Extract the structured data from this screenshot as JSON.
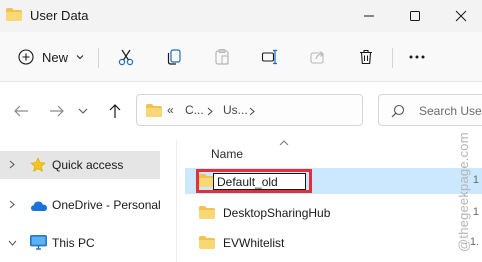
{
  "window": {
    "title": "User Data",
    "controls": [
      "minimize",
      "maximize",
      "close"
    ]
  },
  "toolbar": {
    "new_label": "New",
    "actions": [
      "cut-icon",
      "copy-icon",
      "paste-icon",
      "rename-icon",
      "share-icon",
      "delete-icon",
      "more-icon"
    ]
  },
  "address": {
    "chevron": "«",
    "crumbs": [
      "C...",
      "Us..."
    ],
    "search_placeholder": "Search User"
  },
  "navigation": {
    "items": [
      {
        "label": "Quick access",
        "icon": "star-icon",
        "selected": true
      },
      {
        "label": "OneDrive - Personal",
        "icon": "cloud-icon",
        "selected": false
      },
      {
        "label": "This PC",
        "icon": "monitor-icon",
        "selected": false,
        "expanded": true
      }
    ]
  },
  "content": {
    "column_header": "Name",
    "rename_value": "Default_old",
    "files": [
      {
        "name": "DesktopSharingHub",
        "trailing": "1"
      },
      {
        "name": "EVWhitelist",
        "trailing": "1."
      }
    ],
    "selected_trailing": "1"
  },
  "watermark": "@thegeekpage.com",
  "colors": {
    "folder": "#f2c14e",
    "selection": "#cce8ff",
    "highlight_box": "#e0303a",
    "accent_blue": "#1a73d9"
  }
}
